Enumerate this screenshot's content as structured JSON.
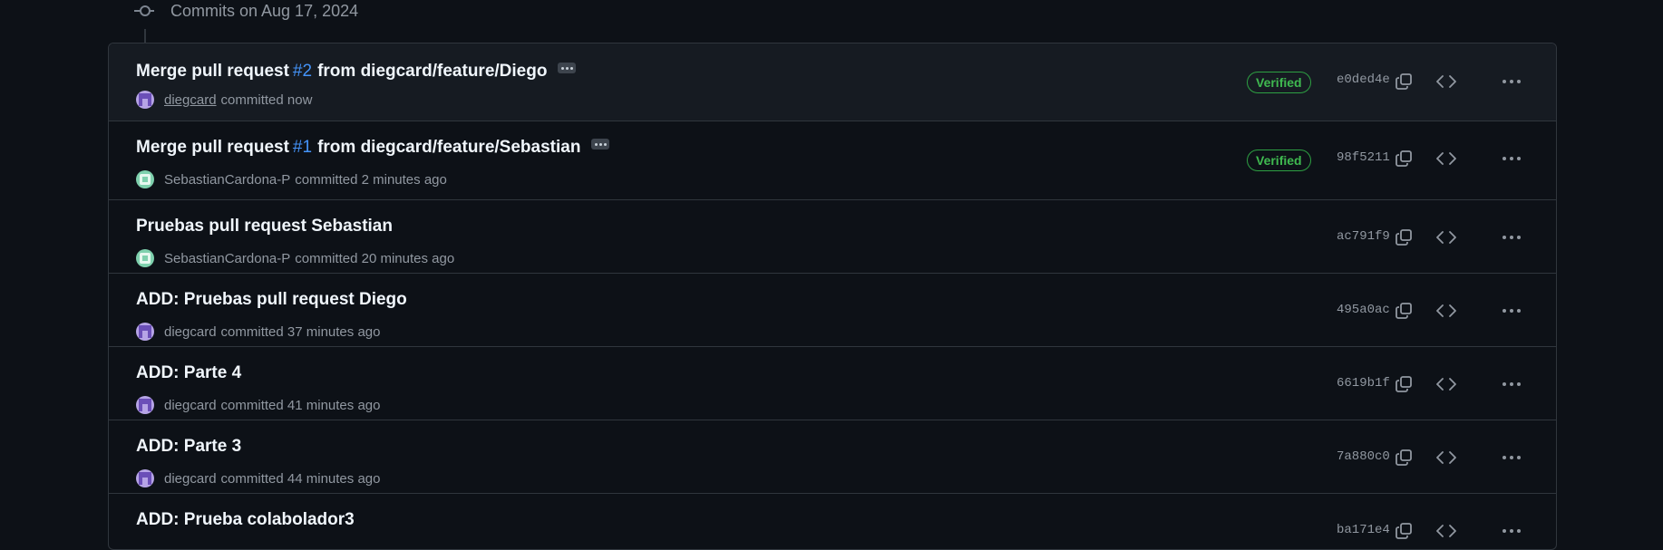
{
  "timeline": {
    "date_label": "Commits on Aug 17, 2024"
  },
  "commits": [
    {
      "title_prefix": "Merge pull request ",
      "pr_number": "#2",
      "title_suffix": "from diegcard/feature/Diego",
      "author": "diegcard",
      "meta": "committed now",
      "verified": "Verified",
      "sha": "e0ded4e",
      "avatar": "purple"
    },
    {
      "title_prefix": "Merge pull request ",
      "pr_number": "#1",
      "title_suffix": "from diegcard/feature/Sebastian",
      "author": "SebastianCardona-P",
      "meta": "committed 2 minutes ago",
      "verified": "Verified",
      "sha": "98f5211",
      "avatar": "green"
    },
    {
      "title": "Pruebas pull request Sebastian",
      "author": "SebastianCardona-P",
      "meta": "committed 20 minutes ago",
      "sha": "ac791f9",
      "avatar": "green"
    },
    {
      "title": "ADD: Pruebas pull request Diego",
      "author": "diegcard",
      "meta": "committed 37 minutes ago",
      "sha": "495a0ac",
      "avatar": "purple"
    },
    {
      "title": "ADD: Parte 4",
      "author": "diegcard",
      "meta": "committed 41 minutes ago",
      "sha": "6619b1f",
      "avatar": "purple"
    },
    {
      "title": "ADD: Parte 3",
      "author": "diegcard",
      "meta": "committed 44 minutes ago",
      "sha": "7a880c0",
      "avatar": "purple"
    },
    {
      "title": "ADD: Prueba colabolador3",
      "sha": "ba171e4"
    }
  ],
  "icons": {
    "timeline": "git-commit-icon",
    "copy": "copy-icon",
    "browse": "code-icon",
    "more": "kebab-horizontal-icon",
    "title_expand": "ellipsis-icon"
  },
  "colors": {
    "background": "#0d1117",
    "row_highlight": "#161b22",
    "border": "#30363d",
    "link": "#4493f8",
    "verified": "#3fb950",
    "muted": "#9198a1"
  }
}
